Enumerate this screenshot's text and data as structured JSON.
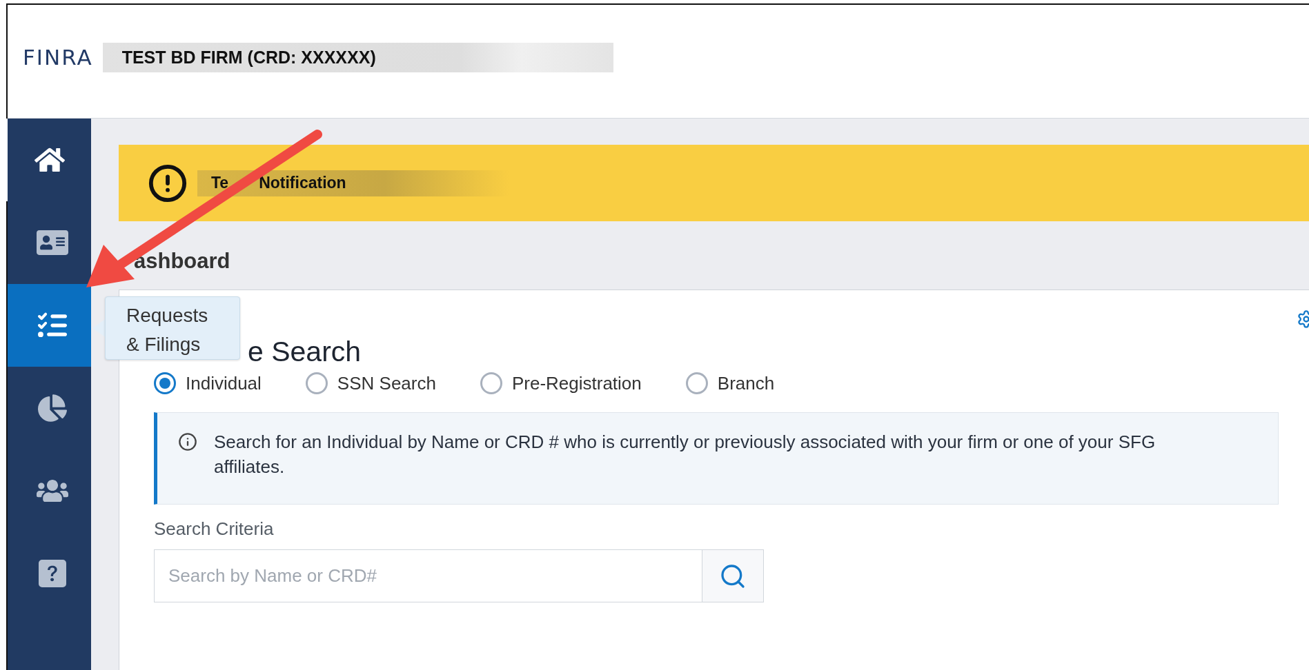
{
  "header": {
    "logo": "FINRA",
    "firm": "TEST BD FIRM (CRD: XXXXXX)"
  },
  "sidebar": {
    "items": [
      {
        "kind": "home",
        "active": true,
        "hovered": false
      },
      {
        "kind": "id-card",
        "active": false,
        "hovered": false
      },
      {
        "kind": "checklist",
        "active": false,
        "hovered": true
      },
      {
        "kind": "pie-chart",
        "active": false,
        "hovered": false
      },
      {
        "kind": "users",
        "active": false,
        "hovered": false
      },
      {
        "kind": "help",
        "active": false,
        "hovered": false
      }
    ]
  },
  "tooltip": "Requests & Filings",
  "notification": {
    "text_start": "Te",
    "text_end": "Notification"
  },
  "page_title": "ashboard",
  "profile_search": {
    "title": "e Search",
    "options": [
      {
        "label": "Individual",
        "selected": true
      },
      {
        "label": "SSN Search",
        "selected": false
      },
      {
        "label": "Pre-Registration",
        "selected": false
      },
      {
        "label": "Branch",
        "selected": false
      }
    ],
    "info": "Search for an Individual by Name or CRD # who is currently or previously associated with your firm or one of your SFG affiliates.",
    "criteria_label": "Search Criteria",
    "search_placeholder": "Search by Name or CRD#"
  }
}
